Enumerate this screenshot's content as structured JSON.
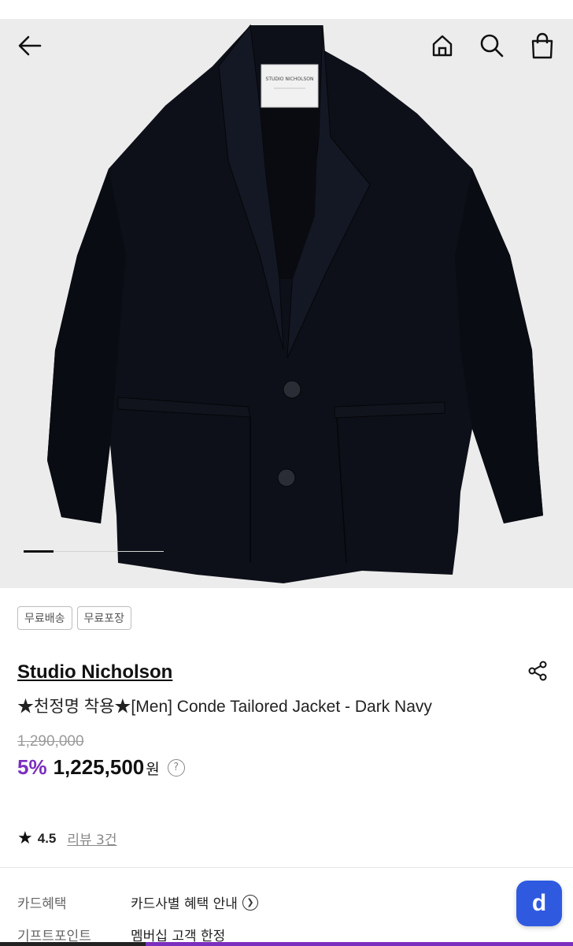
{
  "topbar": {
    "back_icon": "arrow-left-icon",
    "home_icon": "home-icon",
    "search_icon": "search-icon",
    "cart_icon": "shopping-bag-icon"
  },
  "gallery": {
    "image_label": "STUDIO NICHOLSON",
    "active_index": 1,
    "total": 5
  },
  "tags": [
    "무료배송",
    "무료포장"
  ],
  "product": {
    "brand": "Studio Nicholson",
    "title": "★천정명 착용★[Men] Conde Tailored Jacket - Dark Navy",
    "original_price": "1,290,000",
    "discount": "5%",
    "sale_price": "1,225,500",
    "currency": "원",
    "info_icon": "?"
  },
  "rating": {
    "star": "★",
    "score": "4.5",
    "reviews": "리뷰 3건"
  },
  "benefits": [
    {
      "label": "카드혜택",
      "value": "카드사별 혜택 안내"
    },
    {
      "label": "기프트포인트",
      "value": "멤버십 고객 한정"
    }
  ],
  "fab": {
    "label": "d"
  },
  "colors": {
    "accent": "#7b2fbe",
    "fab": "#2f5ae0",
    "hero_bg": "#ececec",
    "jacket": "#0d1018"
  }
}
